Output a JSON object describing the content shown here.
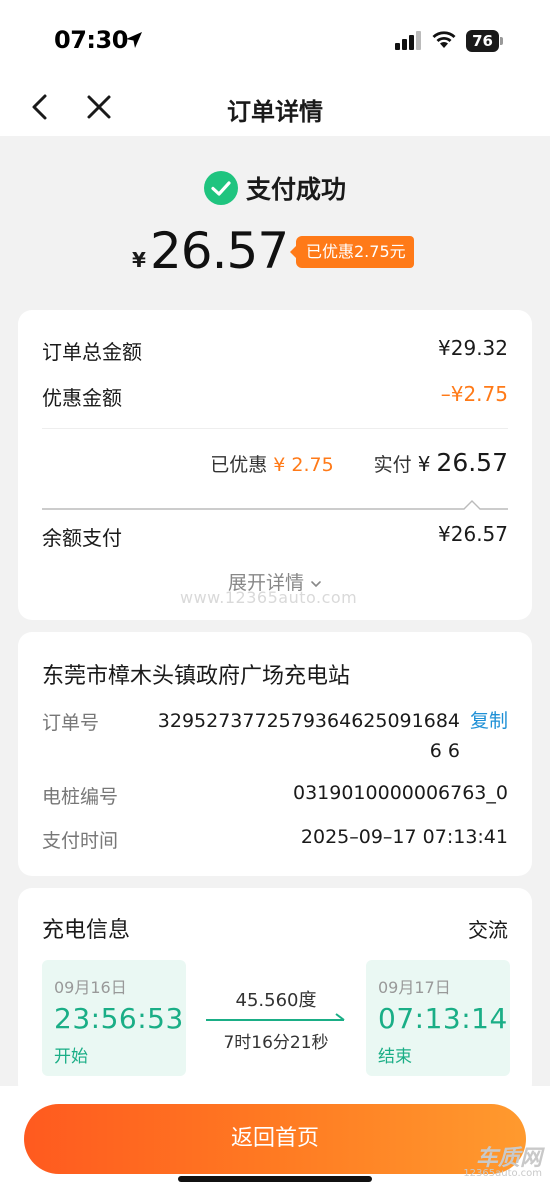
{
  "status_bar": {
    "time": "07:30",
    "battery": "76"
  },
  "nav": {
    "title": "订单详情"
  },
  "payment": {
    "status": "支付成功",
    "currency": "¥",
    "amount": "26.57",
    "discount_tag": "已优惠2.75元"
  },
  "summary": {
    "total_label": "订单总金额",
    "total_value": "¥29.32",
    "discount_label": "优惠金额",
    "discount_value": "–¥2.75",
    "paid_discount_label": "已优惠",
    "paid_discount_value": "¥ 2.75",
    "actual_label": "实付",
    "actual_currency": "¥",
    "actual_value": "26.57",
    "balance_label": "余额支付",
    "balance_value": "¥26.57",
    "expand_label": "展开详情"
  },
  "station": {
    "name": "东莞市樟木头镇政府广场充电站",
    "order_no_label": "订单号",
    "order_no_value": "32952737725793646250916846 6",
    "copy_label": "复制",
    "pile_label": "电桩编号",
    "pile_value": "0319010000006763_0",
    "pay_time_label": "支付时间",
    "pay_time_value": "2025–09–17 07:13:41"
  },
  "charging": {
    "title": "充电信息",
    "type": "交流",
    "start_date": "09月16日",
    "start_time": "23:56:53",
    "start_label": "开始",
    "energy": "45.560度",
    "duration": "7时16分21秒",
    "end_date": "09月17日",
    "end_time": "07:13:14",
    "end_label": "结束"
  },
  "bottom": {
    "home_button": "返回首页"
  },
  "watermark": {
    "text": "www.12365auto.com",
    "logo_text": "车质网",
    "logo_url": "12365auto.com"
  },
  "colors": {
    "accent_orange": "#ff7a18",
    "accent_green": "#1aae86",
    "link_blue": "#1e90d6"
  }
}
